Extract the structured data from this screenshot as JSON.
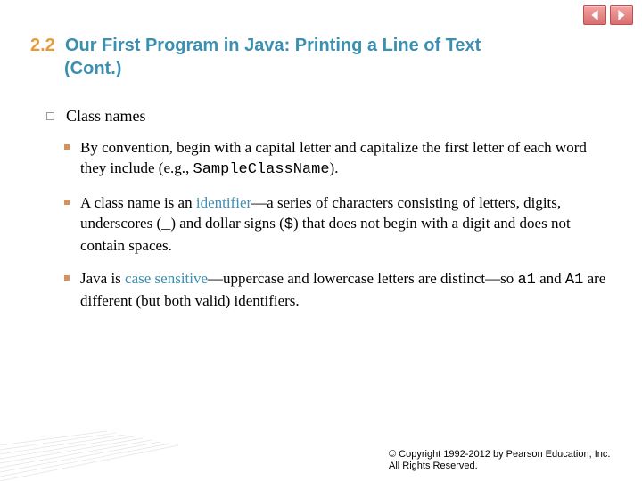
{
  "section_number": "2.2",
  "section_title_line1": "Our First Program in Java: Printing a Line of Text",
  "section_title_line2": "(Cont.)",
  "top_bullet": "Class names",
  "sub1": {
    "part1": "By convention, begin with a capital letter and capitalize the first letter of each word they include (e.g., ",
    "code": "SampleClassName",
    "part2": ")."
  },
  "sub2": {
    "part1": "A class name is an ",
    "kw1": "identifier",
    "part2": "—a series of characters consisting of letters, digits, underscores (",
    "code1": "_",
    "part3": ") and dollar signs (",
    "code2": "$",
    "part4": ") that does not begin with a digit and does not contain spaces."
  },
  "sub3": {
    "part1": "Java is ",
    "kw1": "case sensitive",
    "part2": "—uppercase and lowercase letters are distinct—so ",
    "code1": "a1",
    "part3": " and ",
    "code2": "A1",
    "part4": " are different (but both valid) identifiers."
  },
  "copyright": "© Copyright 1992-2012 by Pearson Education, Inc. All Rights Reserved."
}
